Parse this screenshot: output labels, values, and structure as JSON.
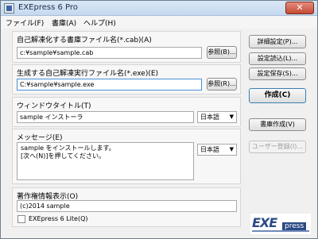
{
  "window": {
    "title": "EXEpress 6 Pro",
    "close_glyph": "✕"
  },
  "menu": [
    {
      "label": "ファイル(F)"
    },
    {
      "label": "書庫(A)"
    },
    {
      "label": "ヘルプ(H)"
    }
  ],
  "cab_section": {
    "label": "自己解凍化する書庫ファイル名(*.cab)(A)",
    "value": "c:¥sample¥sample.cab",
    "browse_label": "参照(B)..."
  },
  "exe_section": {
    "label": "生成する自己解凍実行ファイル名(*.exe)(E)",
    "value": "C:¥sample¥sample.exe",
    "browse_label": "参照(R)..."
  },
  "window_title_section": {
    "label": "ウィンドウタイトル(T)",
    "value": "sample インストーラ",
    "language": "日本語"
  },
  "message_section": {
    "label": "メッセージ(E)",
    "value": "sample をインストールします。\n[次へ(N)]を押してください。",
    "language": "日本語"
  },
  "copyright_section": {
    "label": "著作権情報表示(O)",
    "value": "(c)2014 sample",
    "lite_checkbox_label": "EXEpress 6 Lite(Q)",
    "lite_checked": false
  },
  "side_buttons": {
    "detail": "詳細設定(P)...",
    "load": "設定読込(L)...",
    "save": "設定保存(S)...",
    "create": "作成(C)",
    "create_archive": "書庫作成(V)",
    "user_register": "ユーザー登録(I)..."
  },
  "combo_arrow": "▼",
  "logo": {
    "main": "EXE",
    "sub": "press"
  }
}
